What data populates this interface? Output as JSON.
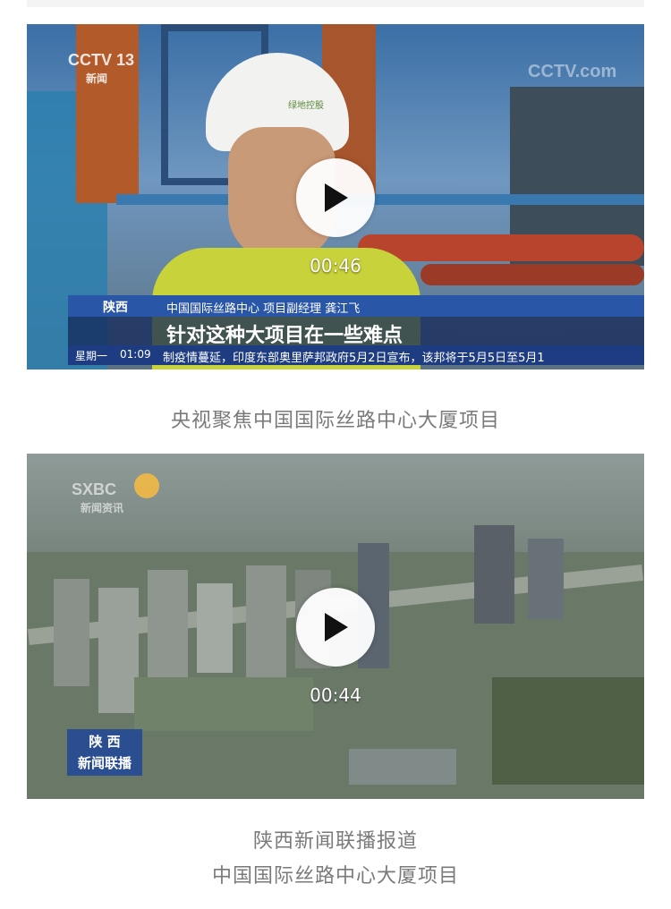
{
  "feed": {
    "videos": [
      {
        "duration": "00:46",
        "caption": "央视聚焦中国国际丝路中心大厦项目",
        "overlay": {
          "channel_logo": "CCTV 13",
          "channel_sub": "新闻",
          "watermark": "CCTV.com",
          "region": "陕西",
          "speaker_title": "中国国际丝路中心 项目副经理 龚江飞",
          "subtitle": "针对这种大项目在一些难点",
          "weekday": "星期一",
          "time": "01:09",
          "ticker": "制疫情蔓延，印度东部奥里萨邦政府5月2日宣布，该邦将于5月5日至5月1"
        },
        "helmet_logo": "绿地控股"
      },
      {
        "duration": "00:44",
        "caption_line1": "陕西新闻联播报道",
        "caption_line2": "中国国际丝路中心大厦项目",
        "overlay": {
          "channel_logo": "SXBC",
          "channel_sub": "新闻资讯",
          "program_region": "陕 西",
          "program_name": "新闻联播"
        }
      }
    ]
  },
  "icons": {
    "play": "play-icon"
  }
}
